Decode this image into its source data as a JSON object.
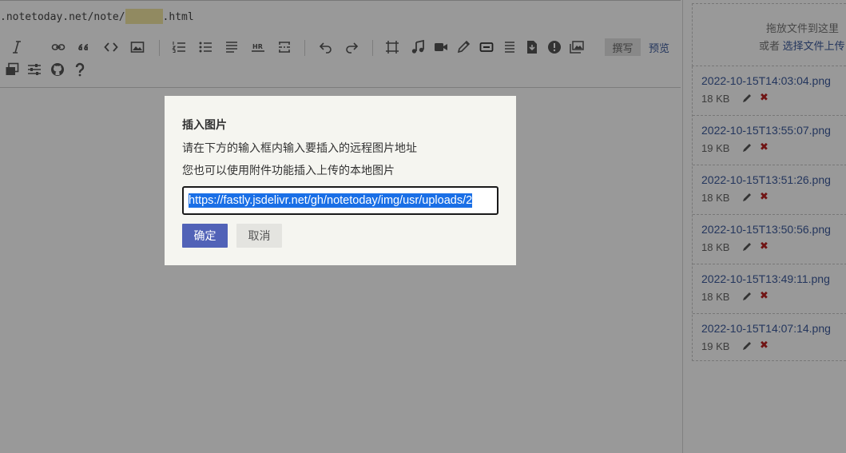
{
  "url_bar": {
    "prefix": ".notetoday.net/note/",
    "suffix": ".html"
  },
  "toolbar": {
    "icons": [
      "italic-icon",
      "link-icon",
      "quote-icon",
      "code-icon",
      "image-icon",
      "ordered-list-icon",
      "unordered-list-icon",
      "heading-icon",
      "hr-icon",
      "more-icon",
      "undo-icon",
      "redo-icon",
      "fullscreen-icon",
      "music-icon",
      "video-icon",
      "pen-icon",
      "button-icon",
      "align-icon",
      "download-icon",
      "alert-icon",
      "gallery-icon",
      "window-icon",
      "sliders-icon",
      "github-icon",
      "help-icon"
    ],
    "write_label": "撰写",
    "preview_label": "预览"
  },
  "attachments": {
    "drop_text": "拖放文件到这里",
    "or_text": "或者",
    "select_link": "选择文件上传",
    "files": [
      {
        "name": "2022-10-15T14:03:04.png",
        "size": "18 KB"
      },
      {
        "name": "2022-10-15T13:55:07.png",
        "size": "19 KB"
      },
      {
        "name": "2022-10-15T13:51:26.png",
        "size": "18 KB"
      },
      {
        "name": "2022-10-15T13:50:56.png",
        "size": "18 KB"
      },
      {
        "name": "2022-10-15T13:49:11.png",
        "size": "18 KB"
      },
      {
        "name": "2022-10-15T14:07:14.png",
        "size": "19 KB"
      }
    ]
  },
  "dialog": {
    "title": "插入图片",
    "line1": "请在下方的输入框内输入要插入的远程图片地址",
    "line2": "您也可以使用附件功能插入上传的本地图片",
    "input_value": "https://fastly.jsdelivr.net/gh/notetoday/img/usr/uploads/2",
    "ok_label": "确定",
    "cancel_label": "取消"
  },
  "colors": {
    "accent": "#5162b7",
    "link": "#3c5a9c",
    "selection": "#1a6fe6",
    "delete": "#b22222"
  }
}
